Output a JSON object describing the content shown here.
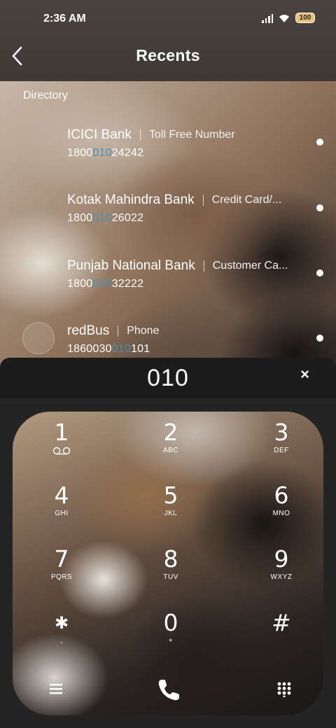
{
  "status_bar": {
    "time": "2:36 AM",
    "battery": "100"
  },
  "header": {
    "title": "Recents",
    "back_icon": "back-arrow-icon"
  },
  "directory": {
    "label": "Directory",
    "items": [
      {
        "name": "ICICI Bank",
        "subtitle": "Toll Free Number",
        "number_pre": "1800",
        "number_match": "010",
        "number_post": "24242"
      },
      {
        "name": "Kotak Mahindra Bank",
        "subtitle": "Credit Card/...",
        "number_pre": "1800",
        "number_match": "010",
        "number_post": "26022"
      },
      {
        "name": "Punjab National Bank",
        "subtitle": "Customer Ca...",
        "number_pre": "1800",
        "number_match": "010",
        "number_post": "32222"
      },
      {
        "name": "redBus",
        "subtitle": "Phone",
        "number_pre": "1860030",
        "number_match": "010",
        "number_post": "101"
      }
    ]
  },
  "dialer": {
    "input_value": "010",
    "clear_label": "×"
  },
  "keypad": [
    {
      "digit": "1",
      "letters": ""
    },
    {
      "digit": "2",
      "letters": "ABC"
    },
    {
      "digit": "3",
      "letters": "DEF"
    },
    {
      "digit": "4",
      "letters": "GHI"
    },
    {
      "digit": "5",
      "letters": "JKL"
    },
    {
      "digit": "6",
      "letters": "MNO"
    },
    {
      "digit": "7",
      "letters": "PQRS"
    },
    {
      "digit": "8",
      "letters": "TUV"
    },
    {
      "digit": "9",
      "letters": "WXYZ"
    },
    {
      "digit": "✱",
      "letters": ","
    },
    {
      "digit": "0",
      "letters": "+"
    },
    {
      "digit": "#",
      "letters": ""
    }
  ],
  "bottom_bar": {
    "menu_icon": "menu-icon",
    "call_icon": "phone-call-icon",
    "dialpad_icon": "dialpad-icon"
  },
  "colors": {
    "header_bg": "#433b38",
    "match_highlight": "#4d8fb3",
    "keypad_bg": "#242424"
  }
}
